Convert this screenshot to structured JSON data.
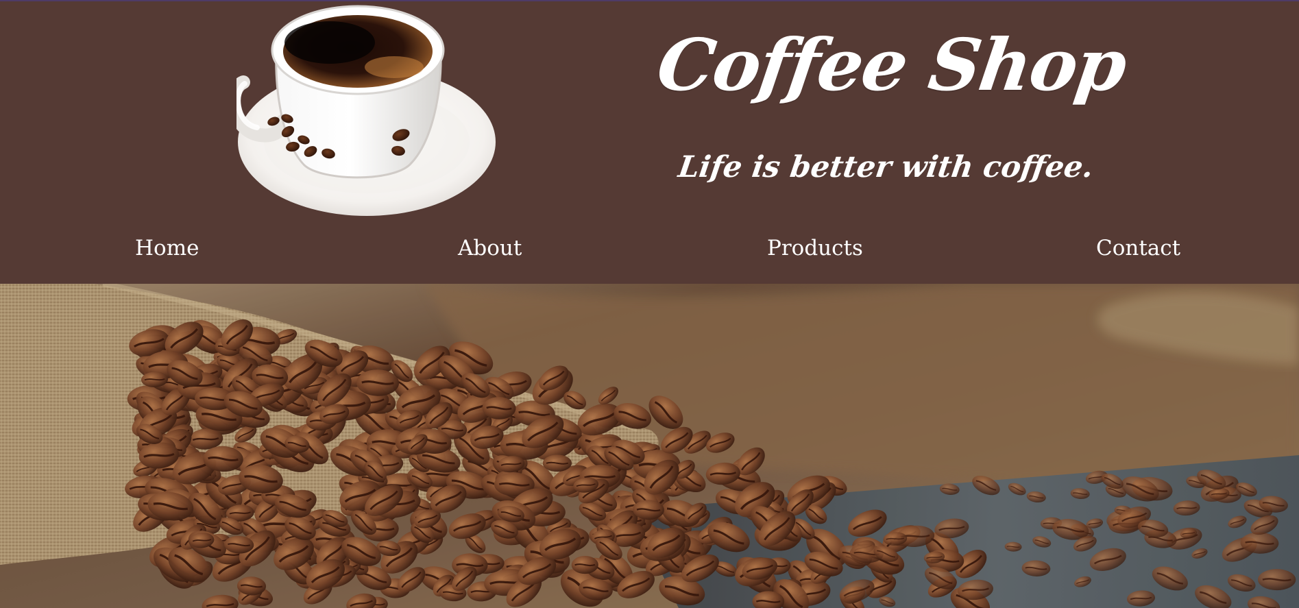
{
  "brand": {
    "title": "Coffee Shop",
    "tagline": "Life is better with coffee."
  },
  "nav": {
    "items": [
      {
        "label": "Home"
      },
      {
        "label": "About"
      },
      {
        "label": "Products"
      },
      {
        "label": "Contact"
      }
    ]
  },
  "hero": {
    "image_alt": ""
  },
  "colors": {
    "header_background": "#553a34",
    "header_text": "#ffffff",
    "burlap": "#b69f7f",
    "bean": "#7a4b2d",
    "table": "#5b6268"
  },
  "icons": {
    "logo": "coffee-cup-icon"
  }
}
